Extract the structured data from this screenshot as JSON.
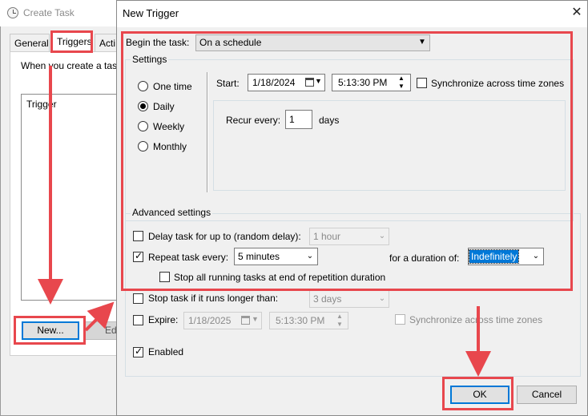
{
  "create_task": {
    "title": "Create Task",
    "tabs": [
      "General",
      "Triggers",
      "Acti"
    ],
    "description_text": "When you create a task",
    "trigger_column_header": "Trigger",
    "new_button": "New...",
    "edit_button": "Ed"
  },
  "dialog": {
    "title": "New Trigger",
    "begin_label": "Begin the task:",
    "begin_value": "On a schedule",
    "settings_legend": "Settings",
    "schedule_options": [
      {
        "label": "One time",
        "checked": false
      },
      {
        "label": "Daily",
        "checked": true
      },
      {
        "label": "Weekly",
        "checked": false
      },
      {
        "label": "Monthly",
        "checked": false
      }
    ],
    "start_label": "Start:",
    "start_date": "1/18/2024",
    "start_time": "5:13:30 PM",
    "sync_label": "Synchronize across time zones",
    "sync_checked": false,
    "recur_label": "Recur every:",
    "recur_value": "1",
    "recur_unit": "days",
    "advanced_legend": "Advanced settings",
    "delay_label": "Delay task for up to (random delay):",
    "delay_checked": false,
    "delay_value": "1 hour",
    "repeat_label": "Repeat task every:",
    "repeat_checked": true,
    "repeat_value": "5 minutes",
    "duration_label": "for a duration of:",
    "duration_value": "Indefinitely",
    "stop_all_label": "Stop all running tasks at end of repetition duration",
    "stop_all_checked": false,
    "stop_long_label": "Stop task if it runs longer than:",
    "stop_long_checked": false,
    "stop_long_value": "3 days",
    "expire_label": "Expire:",
    "expire_checked": false,
    "expire_date": "1/18/2025",
    "expire_time": "5:13:30 PM",
    "expire_sync_label": "Synchronize across time zones",
    "enabled_label": "Enabled",
    "enabled_checked": true,
    "ok_button": "OK",
    "cancel_button": "Cancel"
  },
  "annotation_color": "#e8474d"
}
